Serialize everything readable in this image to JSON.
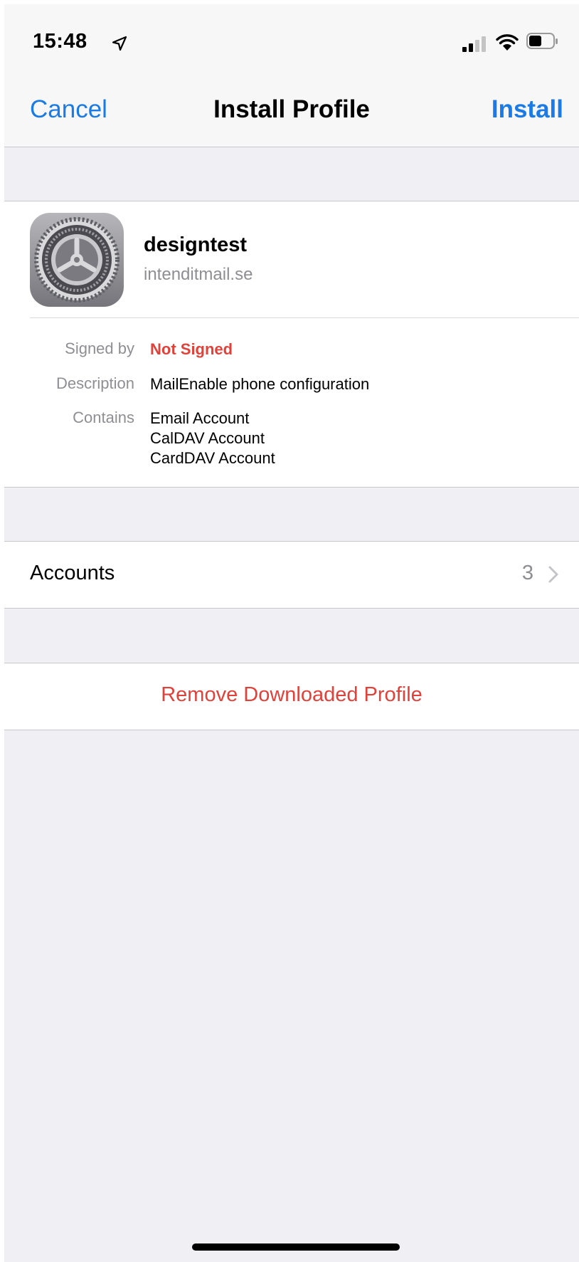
{
  "status_bar": {
    "time": "15:48",
    "icons": [
      "location-arrow-icon",
      "cellular-signal-icon",
      "wifi-icon",
      "battery-icon"
    ]
  },
  "nav": {
    "cancel_label": "Cancel",
    "title": "Install Profile",
    "install_label": "Install"
  },
  "profile": {
    "icon": "settings-gear-icon",
    "name": "designtest",
    "domain": "intenditmail.se",
    "details": {
      "signed_by_label": "Signed by",
      "signed_by_value": "Not Signed",
      "description_label": "Description",
      "description_value": "MailEnable phone configuration",
      "contains_label": "Contains",
      "contains_values": [
        "Email Account",
        "CalDAV Account",
        "CardDAV Account"
      ]
    }
  },
  "accounts": {
    "label": "Accounts",
    "count": "3"
  },
  "remove": {
    "label": "Remove Downloaded Profile"
  },
  "colors": {
    "accent_blue": "#1a7be6",
    "destructive_red": "#e0423a",
    "secondary_gray": "#8e8e93",
    "grouped_background": "#efeff4"
  }
}
